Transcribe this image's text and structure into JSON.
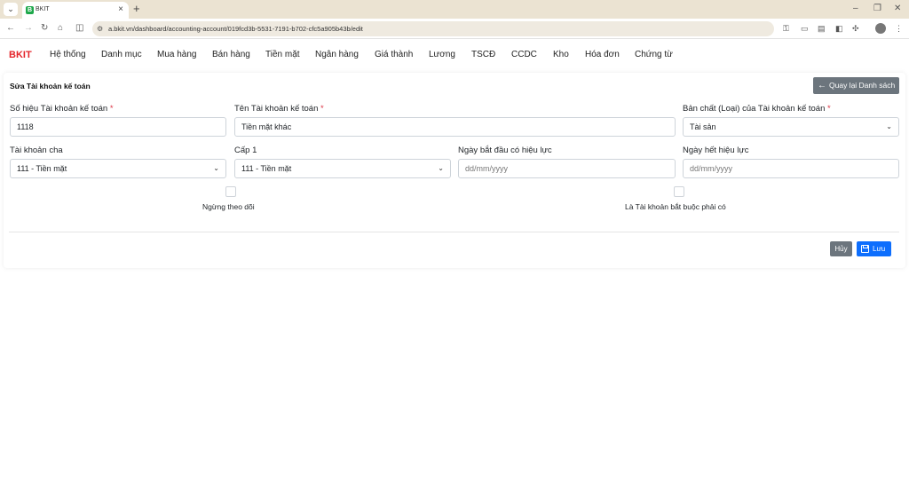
{
  "browser": {
    "tab_title": "BKIT",
    "tab_favicon": "B",
    "url": "a.bkit.vn/dashboard/accounting-account/019fcd3b-5531-7191-b702-cfc5a905b43b/edit"
  },
  "app": {
    "brand": "BKIT",
    "brand_color": "#e4242a",
    "menu": [
      "Hệ thống",
      "Danh mục",
      "Mua hàng",
      "Bán hàng",
      "Tiền mặt",
      "Ngân hàng",
      "Giá thành",
      "Lương",
      "TSCĐ",
      "CCDC",
      "Kho",
      "Hóa đơn",
      "Chứng từ"
    ]
  },
  "form": {
    "title": "Sửa Tài khoản kế toán",
    "back_label": "Quay lại Danh sách",
    "fields": {
      "account_number": {
        "label": "Số hiệu Tài khoản kế toán",
        "required": "*",
        "value": "1118"
      },
      "account_name": {
        "label": "Tên Tài khoản kế toán",
        "required": "*",
        "value": "Tiền mặt khác"
      },
      "nature": {
        "label": "Bản chất (Loại) của Tài khoản kế toán",
        "required": "*",
        "value": "Tài sản"
      },
      "parent": {
        "label": "Tài khoản cha",
        "value": "111 - Tiền mặt"
      },
      "level1": {
        "label": "Cấp 1",
        "value": "111 - Tiền mặt"
      },
      "start_date": {
        "label": "Ngày bắt đầu có hiệu lực",
        "placeholder": "dd/mm/yyyy"
      },
      "end_date": {
        "label": "Ngày hết hiệu lực",
        "placeholder": "dd/mm/yyyy"
      }
    },
    "checkboxes": {
      "stop_tracking": {
        "label": "Ngừng theo dõi",
        "checked": false
      },
      "required_account": {
        "label": "Là Tài khoản bắt buộc phải có",
        "checked": false
      }
    },
    "cancel_label": "Hủy",
    "save_label": "Lưu"
  }
}
